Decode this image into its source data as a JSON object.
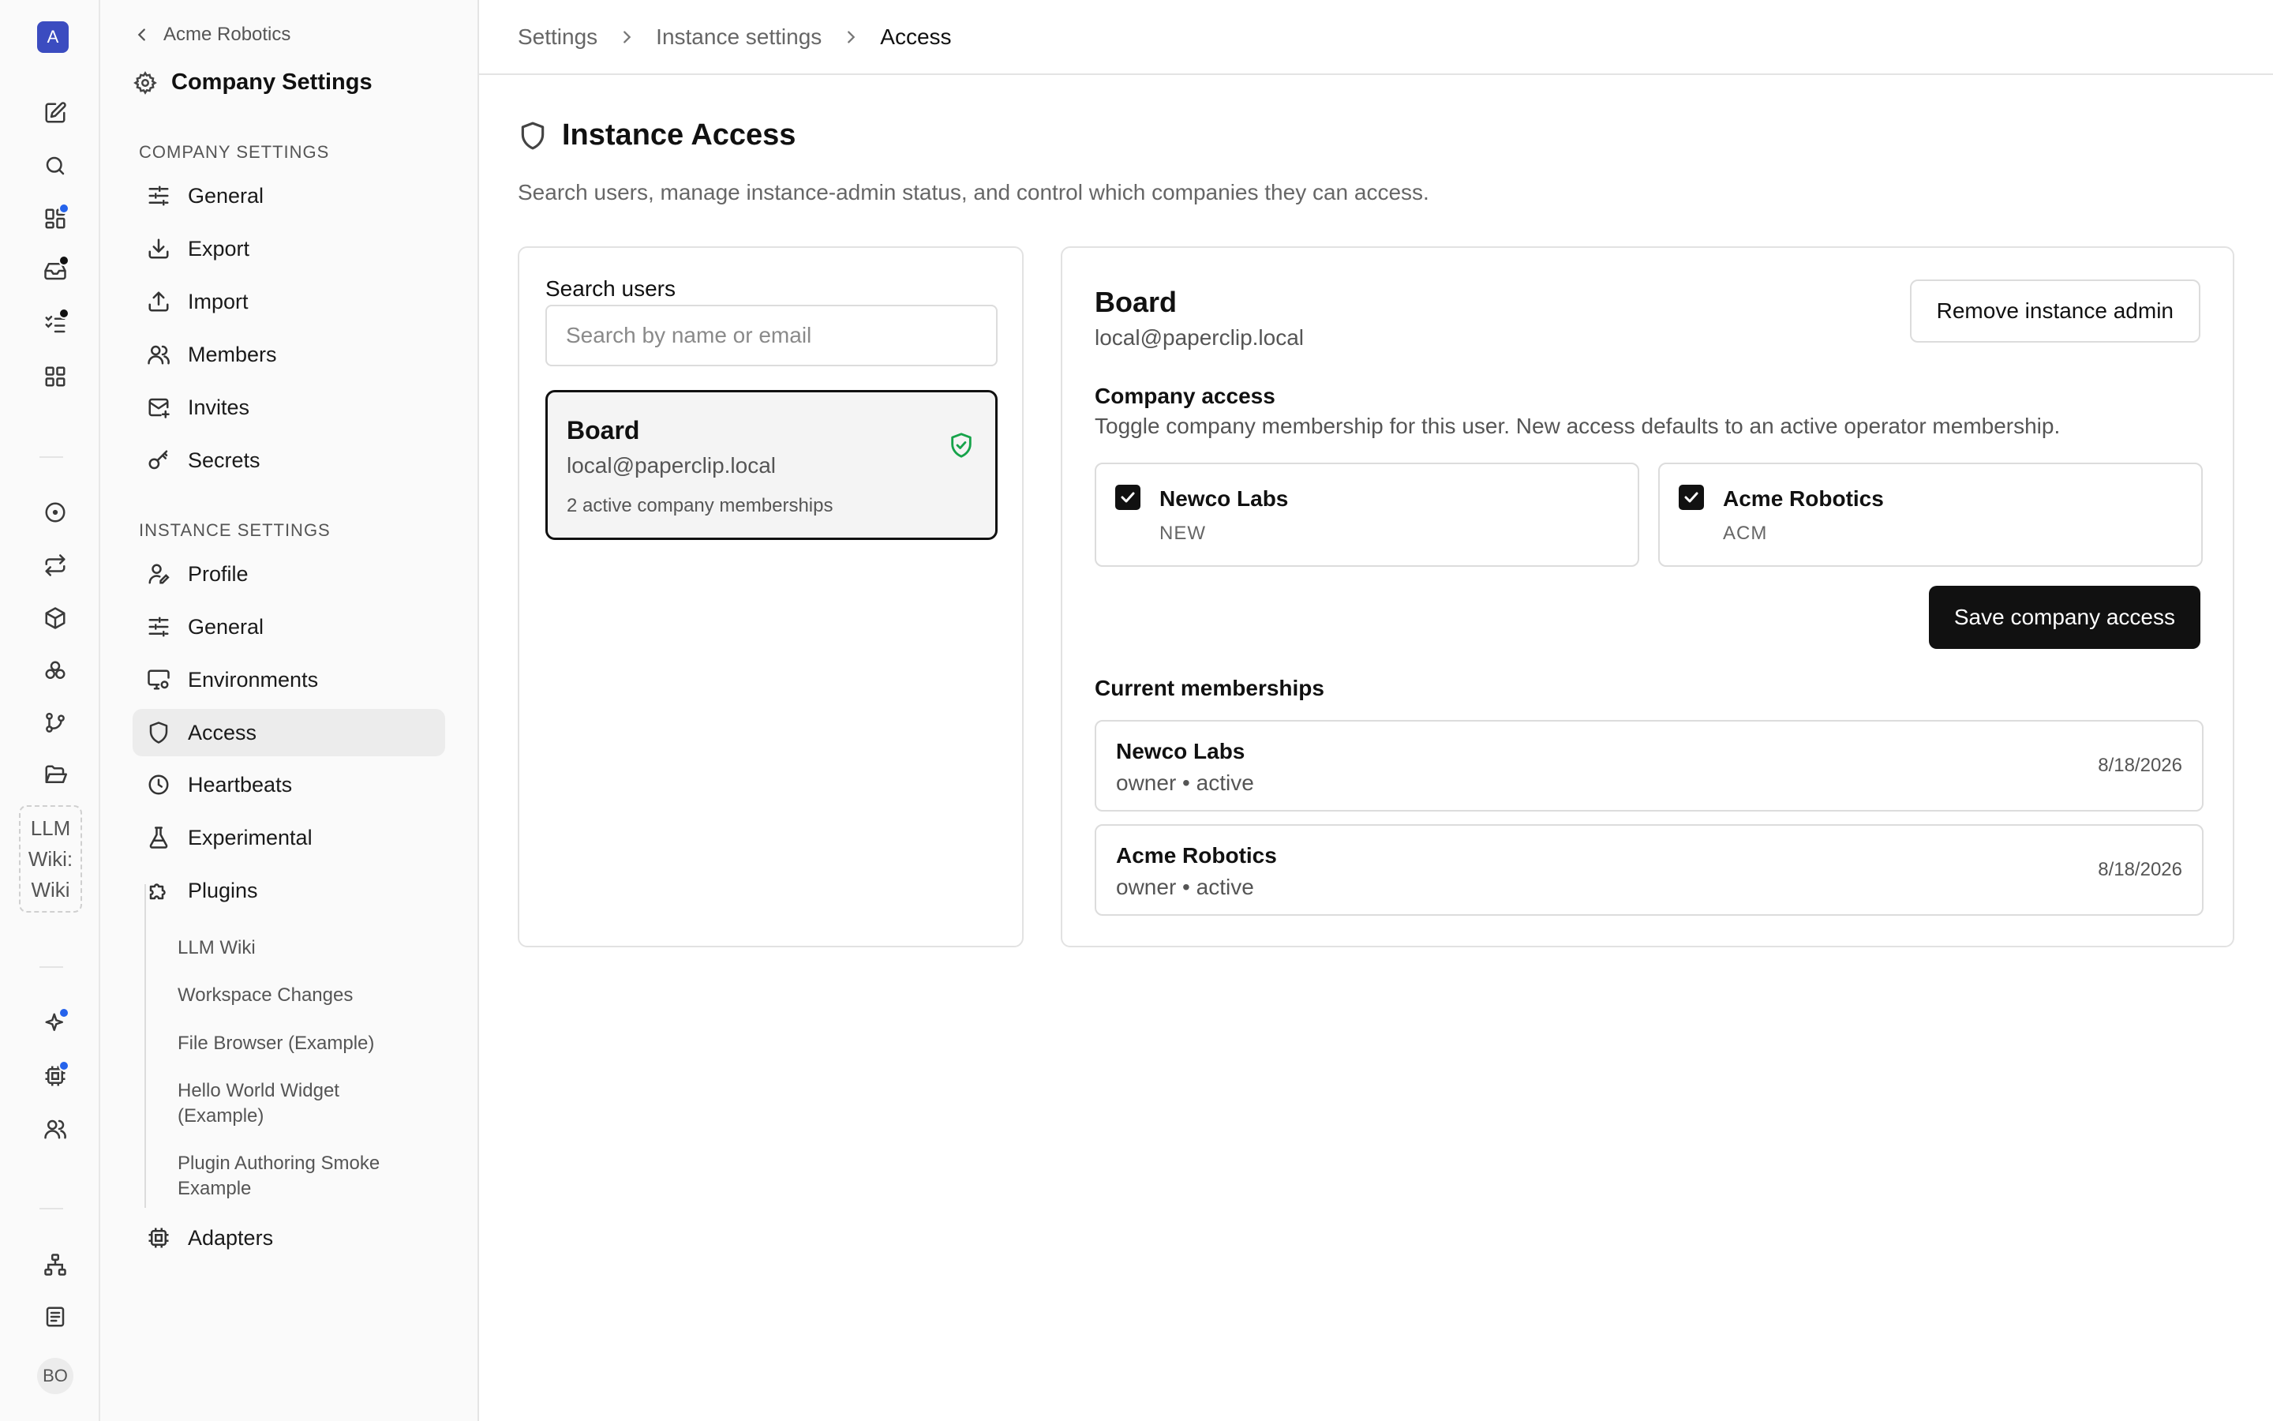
{
  "rail": {
    "logo_letter": "A",
    "wiki_label": [
      "LLM",
      "Wiki:",
      "Wiki"
    ],
    "avatar_initials": "BO",
    "dot_colors": {
      "blue": "#2563eb",
      "black": "#111111"
    }
  },
  "sidebar": {
    "back_label": "Acme Robotics",
    "title": "Company Settings",
    "company_section_label": "COMPANY SETTINGS",
    "company_items": [
      {
        "label": "General",
        "icon": "sliders-icon"
      },
      {
        "label": "Export",
        "icon": "download-icon"
      },
      {
        "label": "Import",
        "icon": "upload-icon"
      },
      {
        "label": "Members",
        "icon": "users-icon"
      },
      {
        "label": "Invites",
        "icon": "mail-plus-icon"
      },
      {
        "label": "Secrets",
        "icon": "key-icon"
      }
    ],
    "instance_section_label": "INSTANCE SETTINGS",
    "instance_items": [
      {
        "label": "Profile",
        "icon": "user-pen-icon"
      },
      {
        "label": "General",
        "icon": "sliders-icon"
      },
      {
        "label": "Environments",
        "icon": "monitor-cog-icon"
      },
      {
        "label": "Access",
        "icon": "shield-icon",
        "active": true
      },
      {
        "label": "Heartbeats",
        "icon": "clock-icon"
      },
      {
        "label": "Experimental",
        "icon": "flask-icon"
      },
      {
        "label": "Plugins",
        "icon": "puzzle-icon"
      }
    ],
    "plugin_items": [
      "LLM Wiki",
      "Workspace Changes",
      "File Browser (Example)",
      "Hello World Widget (Example)",
      "Plugin Authoring Smoke Example"
    ],
    "adapters_label": "Adapters"
  },
  "breadcrumb": [
    "Settings",
    "Instance settings",
    "Access"
  ],
  "page": {
    "title": "Instance Access",
    "description": "Search users, manage instance-admin status, and control which companies they can access."
  },
  "search": {
    "label": "Search users",
    "placeholder": "Search by name or email",
    "value": ""
  },
  "user_result": {
    "name": "Board",
    "email": "local@paperclip.local",
    "memberships": "2 active company memberships"
  },
  "detail": {
    "name": "Board",
    "email": "local@paperclip.local",
    "remove_admin_label": "Remove instance admin",
    "company_access_label": "Company access",
    "company_access_desc": "Toggle company membership for this user. New access defaults to an active operator membership.",
    "companies": [
      {
        "name": "Newco Labs",
        "code": "NEW",
        "checked": true
      },
      {
        "name": "Acme Robotics",
        "code": "ACM",
        "checked": true
      }
    ],
    "save_label": "Save company access",
    "current_memberships_label": "Current memberships",
    "memberships": [
      {
        "company": "Newco Labs",
        "status": "owner • active",
        "date": "8/18/2026"
      },
      {
        "company": "Acme Robotics",
        "status": "owner • active",
        "date": "8/18/2026"
      }
    ]
  }
}
